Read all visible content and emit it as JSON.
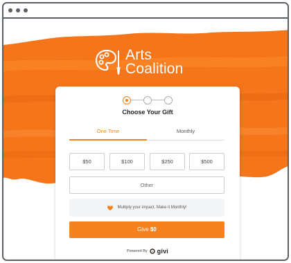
{
  "window": {
    "controls": [
      "close",
      "minimize",
      "maximize"
    ]
  },
  "brand": {
    "logo_line1": "Arts",
    "logo_line2": "Coalition",
    "logo_icon": "palette-brush-icon"
  },
  "form": {
    "steps_total": 3,
    "active_step": 1,
    "title": "Choose Your Gift",
    "tabs": [
      {
        "label": "One Time",
        "active": true
      },
      {
        "label": "Monthly",
        "active": false
      }
    ],
    "amounts": [
      "$50",
      "$100",
      "$250",
      "$500"
    ],
    "other_label": "Other",
    "callout": {
      "icon": "heart-sparkle-icon",
      "text": "Multiply your impact. Make it Monthly!"
    },
    "give": {
      "prefix": "Give ",
      "amount": "$0"
    },
    "powered_by": {
      "label": "Powered By",
      "brand": "givi"
    }
  },
  "colors": {
    "accent": "#f5821f",
    "paint": "#f4751a",
    "frame": "#5a5f66"
  }
}
